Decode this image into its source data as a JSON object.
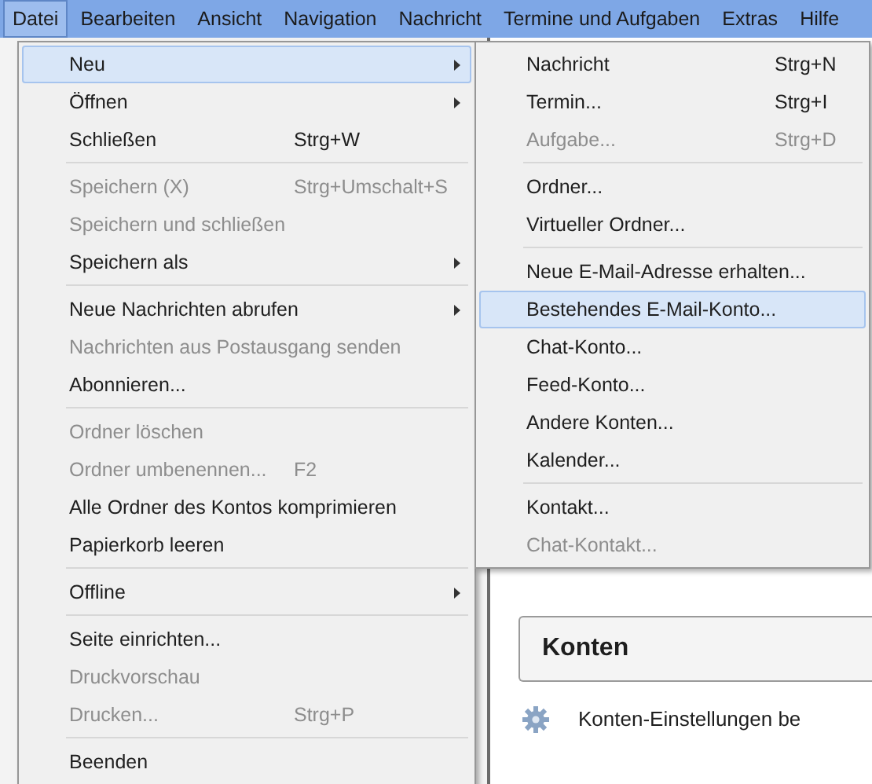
{
  "menubar": [
    {
      "label": "Datei",
      "selected": true
    },
    {
      "label": "Bearbeiten",
      "selected": false
    },
    {
      "label": "Ansicht",
      "selected": false
    },
    {
      "label": "Navigation",
      "selected": false
    },
    {
      "label": "Nachricht",
      "selected": false
    },
    {
      "label": "Termine und Aufgaben",
      "selected": false
    },
    {
      "label": "Extras",
      "selected": false
    },
    {
      "label": "Hilfe",
      "selected": false
    }
  ],
  "file_menu": [
    {
      "kind": "item",
      "label": "Neu",
      "submenu": true,
      "disabled": false,
      "selected": true
    },
    {
      "kind": "item",
      "label": "Öffnen",
      "submenu": true,
      "disabled": false,
      "selected": false
    },
    {
      "kind": "item",
      "label": "Schließen",
      "shortcut": "Strg+W",
      "submenu": false,
      "disabled": false,
      "selected": false
    },
    {
      "kind": "separator"
    },
    {
      "kind": "item",
      "label": "Speichern (X)",
      "shortcut": "Strg+Umschalt+S",
      "submenu": false,
      "disabled": true,
      "selected": false
    },
    {
      "kind": "item",
      "label": "Speichern und schließen",
      "submenu": false,
      "disabled": true,
      "selected": false
    },
    {
      "kind": "item",
      "label": "Speichern als",
      "submenu": true,
      "disabled": false,
      "selected": false
    },
    {
      "kind": "separator"
    },
    {
      "kind": "item",
      "label": "Neue Nachrichten abrufen",
      "submenu": true,
      "disabled": false,
      "selected": false
    },
    {
      "kind": "item",
      "label": "Nachrichten aus Postausgang senden",
      "submenu": false,
      "disabled": true,
      "selected": false
    },
    {
      "kind": "item",
      "label": "Abonnieren...",
      "submenu": false,
      "disabled": false,
      "selected": false
    },
    {
      "kind": "separator"
    },
    {
      "kind": "item",
      "label": "Ordner löschen",
      "submenu": false,
      "disabled": true,
      "selected": false
    },
    {
      "kind": "item",
      "label": "Ordner umbenennen...",
      "shortcut": "F2",
      "submenu": false,
      "disabled": true,
      "selected": false
    },
    {
      "kind": "item",
      "label": "Alle Ordner des Kontos komprimieren",
      "submenu": false,
      "disabled": false,
      "selected": false
    },
    {
      "kind": "item",
      "label": "Papierkorb leeren",
      "submenu": false,
      "disabled": false,
      "selected": false
    },
    {
      "kind": "separator"
    },
    {
      "kind": "item",
      "label": "Offline",
      "submenu": true,
      "disabled": false,
      "selected": false
    },
    {
      "kind": "separator"
    },
    {
      "kind": "item",
      "label": "Seite einrichten...",
      "submenu": false,
      "disabled": false,
      "selected": false
    },
    {
      "kind": "item",
      "label": "Druckvorschau",
      "submenu": false,
      "disabled": true,
      "selected": false
    },
    {
      "kind": "item",
      "label": "Drucken...",
      "shortcut": "Strg+P",
      "submenu": false,
      "disabled": true,
      "selected": false
    },
    {
      "kind": "separator"
    },
    {
      "kind": "item",
      "label": "Beenden",
      "submenu": false,
      "disabled": false,
      "selected": false
    }
  ],
  "new_submenu": [
    {
      "kind": "item",
      "label": "Nachricht",
      "shortcut": "Strg+N",
      "disabled": false,
      "selected": false
    },
    {
      "kind": "item",
      "label": "Termin...",
      "shortcut": "Strg+I",
      "disabled": false,
      "selected": false
    },
    {
      "kind": "item",
      "label": "Aufgabe...",
      "shortcut": "Strg+D",
      "disabled": true,
      "selected": false
    },
    {
      "kind": "separator"
    },
    {
      "kind": "item",
      "label": "Ordner...",
      "disabled": false,
      "selected": false
    },
    {
      "kind": "item",
      "label": "Virtueller Ordner...",
      "disabled": false,
      "selected": false
    },
    {
      "kind": "separator"
    },
    {
      "kind": "item",
      "label": "Neue E-Mail-Adresse erhalten...",
      "disabled": false,
      "selected": false
    },
    {
      "kind": "item",
      "label": "Bestehendes E-Mail-Konto...",
      "disabled": false,
      "selected": true
    },
    {
      "kind": "item",
      "label": "Chat-Konto...",
      "disabled": false,
      "selected": false
    },
    {
      "kind": "item",
      "label": "Feed-Konto...",
      "disabled": false,
      "selected": false
    },
    {
      "kind": "item",
      "label": "Andere Konten...",
      "disabled": false,
      "selected": false
    },
    {
      "kind": "item",
      "label": "Kalender...",
      "disabled": false,
      "selected": false
    },
    {
      "kind": "separator"
    },
    {
      "kind": "item",
      "label": "Kontakt...",
      "disabled": false,
      "selected": false
    },
    {
      "kind": "item",
      "label": "Chat-Kontakt...",
      "disabled": true,
      "selected": false
    }
  ],
  "content": {
    "section_title": "Konten",
    "rows": [
      {
        "label": "Konten-Einstellungen be"
      }
    ]
  }
}
